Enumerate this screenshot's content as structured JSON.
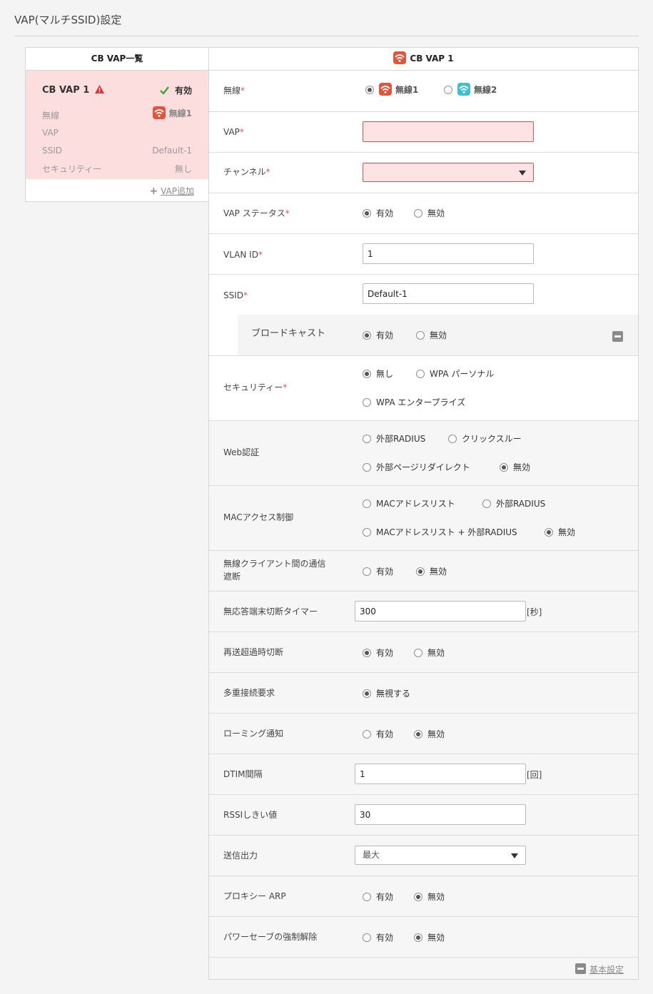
{
  "page": {
    "title": "VAP(マルチSSID)設定"
  },
  "list": {
    "header": "CB VAP一覧",
    "card": {
      "name": "CB VAP 1",
      "status": "有効",
      "radio_label": "無線",
      "radio_value": "無線1",
      "vap_label": "VAP",
      "ssid_label": "SSID",
      "ssid_value": "Default-1",
      "security_label": "セキュリティー",
      "security_value": "無し"
    },
    "add_label": "VAP追加"
  },
  "form": {
    "header": "CB VAP 1",
    "required_mark": "*",
    "wireless": {
      "label": "無線",
      "opt1": "無線1",
      "opt2": "無線2",
      "selected": 1
    },
    "vap": {
      "label": "VAP",
      "value": ""
    },
    "channel": {
      "label": "チャンネル",
      "value": ""
    },
    "vap_status": {
      "label": "VAP ステータス",
      "opt1": "有効",
      "opt2": "無効",
      "selected": 1
    },
    "vlan": {
      "label": "VLAN ID",
      "value": "1"
    },
    "ssid": {
      "label": "SSID",
      "value": "Default-1"
    },
    "broadcast": {
      "label": "ブロードキャスト",
      "opt1": "有効",
      "opt2": "無効",
      "selected": 1
    },
    "security": {
      "label": "セキュリティー",
      "opt1": "無し",
      "opt2": "WPA パーソナル",
      "opt3": "WPA エンタープライズ",
      "selected": 1
    },
    "web_auth": {
      "label": "Web認証",
      "opt1": "外部RADIUS",
      "opt2": "クリックスルー",
      "opt3": "外部ページリダイレクト",
      "opt4": "無効",
      "selected": 4
    },
    "mac_access": {
      "label": "MACアクセス制御",
      "opt1": "MACアドレスリスト",
      "opt2": "外部RADIUS",
      "opt3": "MACアドレスリスト + 外部RADIUS",
      "opt4": "無効",
      "selected": 4
    },
    "client_isolation": {
      "label_line1": "無線クライアント間の通信",
      "label_line2": "遮断",
      "opt1": "有効",
      "opt2": "無効",
      "selected": 2
    },
    "idle_timer": {
      "label": "無応答端末切断タイマー",
      "value": "300",
      "unit": "[秒]"
    },
    "retry_disconnect": {
      "label": "再送超過時切断",
      "opt1": "有効",
      "opt2": "無効",
      "selected": 1
    },
    "multi_connect": {
      "label": "多重接続要求",
      "opt1": "無視する",
      "selected": 1
    },
    "roaming": {
      "label": "ローミング通知",
      "opt1": "有効",
      "opt2": "無効",
      "selected": 2
    },
    "dtim": {
      "label": "DTIM間隔",
      "value": "1",
      "unit": "[回]"
    },
    "rssi": {
      "label": "RSSIしきい値",
      "value": "30"
    },
    "tx_power": {
      "label": "送信出力",
      "value": "最大"
    },
    "proxy_arp": {
      "label": "プロキシー ARP",
      "opt1": "有効",
      "opt2": "無効",
      "selected": 2
    },
    "power_save": {
      "label": "パワーセーブの強制解除",
      "opt1": "有効",
      "opt2": "無効",
      "selected": 2
    },
    "basic_settings_link": "基本設定"
  },
  "colors": {
    "error_bg": "#fde3e3",
    "error_border": "#d9534f",
    "card_bg": "#fcdede",
    "radio1": "#e2553d",
    "radio2": "#3dbfcf",
    "ok_green": "#3aa53a"
  },
  "icons": [
    "wifi-icon",
    "warning-icon",
    "check-icon",
    "plus-icon",
    "minus-icon",
    "chevron-down-icon"
  ]
}
